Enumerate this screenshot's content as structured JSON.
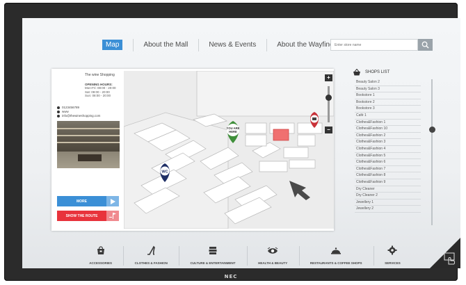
{
  "monitor": {
    "brand": "NEC"
  },
  "nav": {
    "items": [
      {
        "label": "Map",
        "active": true
      },
      {
        "label": "About the Mall",
        "active": false
      },
      {
        "label": "News & Events",
        "active": false
      },
      {
        "label": "About the Wayfinder",
        "active": false
      }
    ],
    "search_placeholder": "Enter store name"
  },
  "shop_info": {
    "name": "The wine Shopping",
    "hours_title": "OPENING HOURS:",
    "hours": [
      "Mon-Fri: 08:00 - 20:00",
      "Sat: 09:00 - 20:00",
      "Sun: 08:00 - 20:00"
    ],
    "phone": "0123456789",
    "web": "www",
    "email": "info@thewineshopping.com",
    "more_label": "MORE",
    "route_label": "SHOW THE ROUTE"
  },
  "map": {
    "you_are_here": "YOU ARE HERE",
    "wc_label": "WC"
  },
  "shops": {
    "title": "SHOPS LIST",
    "items": [
      "Beauty Salon 2",
      "Beauty Salon 3",
      "Bookstore 1",
      "Bookstore 2",
      "Bookstore 3",
      "Café 1",
      "Clothes&Fashion 1",
      "Clothes&Fashion 10",
      "Clothes&Fashion 2",
      "Clothes&Fashion 3",
      "Clothes&Fashion 4",
      "Clothes&Fashion 5",
      "Clothes&Fashion 6",
      "Clothes&Fashion 7",
      "Clothes&Fashion 8",
      "Clothes&Fashion 9",
      "Dry Cleaner",
      "Dry Cleaner 2",
      "Jewellery 1",
      "Jewellery 2"
    ]
  },
  "categories": [
    {
      "label": "ACCESSORIES",
      "icon": "bag-icon"
    },
    {
      "label": "CLOTHES & FASHION",
      "icon": "heel-icon"
    },
    {
      "label": "CULTURE & ENTERTAINMENT",
      "icon": "books-icon"
    },
    {
      "label": "HEALTH & BEAUTY",
      "icon": "eye-icon"
    },
    {
      "label": "RESTAURANTS & COFFEE SHOPS",
      "icon": "cloche-icon"
    },
    {
      "label": "SERVICES",
      "icon": "gear-icon"
    }
  ],
  "colors": {
    "accent_blue": "#3b8fd6",
    "accent_red": "#e8333c",
    "pin_green": "#3f8f3a",
    "pin_navy": "#1f2f66",
    "pin_red": "#c93239",
    "highlight_shop": "#f07070"
  }
}
